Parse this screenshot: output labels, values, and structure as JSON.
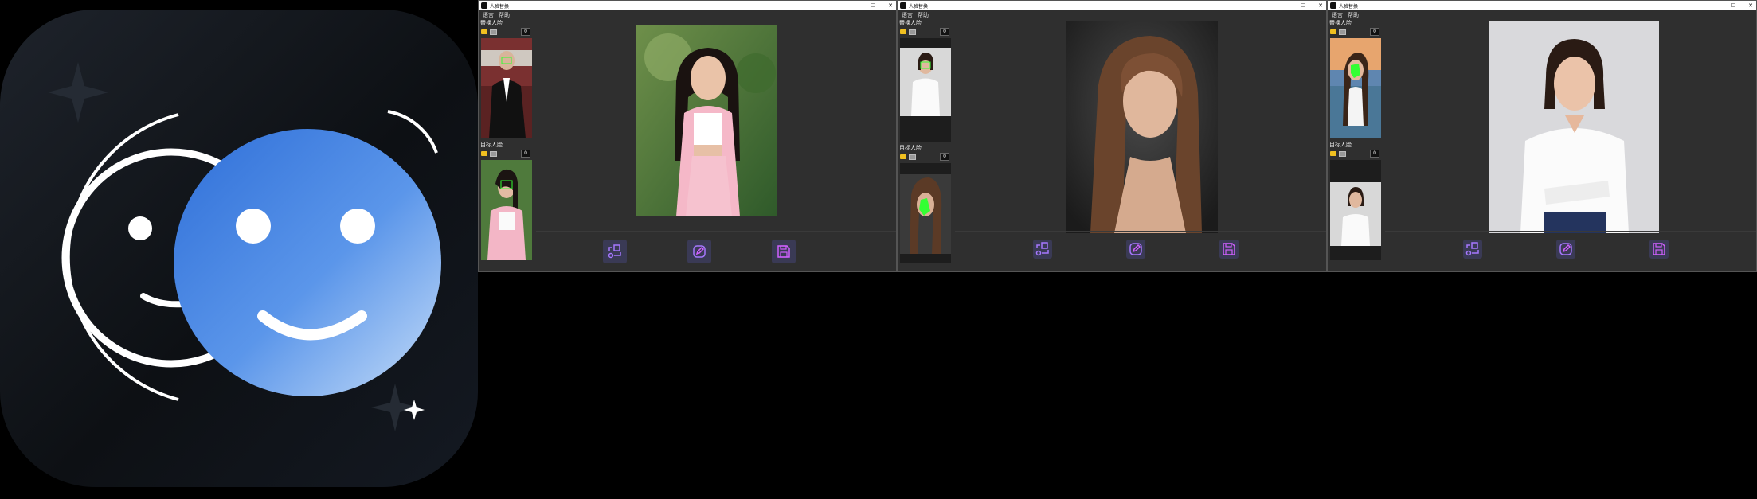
{
  "window1": {
    "title": "人脸替换",
    "menu": [
      "语言",
      "帮助"
    ],
    "replace_face_label": "替换人脸",
    "target_face_label": "目标人脸",
    "replace_count": "0",
    "target_count": "0"
  },
  "window2": {
    "title": "人脸替换",
    "menu": [
      "语言",
      "帮助"
    ],
    "replace_face_label": "替换人脸",
    "target_face_label": "目标人脸",
    "replace_count": "0",
    "target_count": "0"
  },
  "window3": {
    "title": "人脸替换",
    "menu": [
      "语言",
      "帮助"
    ],
    "replace_face_label": "替换人脸",
    "target_face_label": "目标人脸",
    "replace_count": "0",
    "target_count": "0"
  },
  "icons": {
    "swap": "swap-faces-icon",
    "edit": "edit-icon",
    "save": "save-icon"
  },
  "colors": {
    "accent": "#8c52ff",
    "face_marker": "#33ff33",
    "window_bg": "#2f2f2f"
  }
}
